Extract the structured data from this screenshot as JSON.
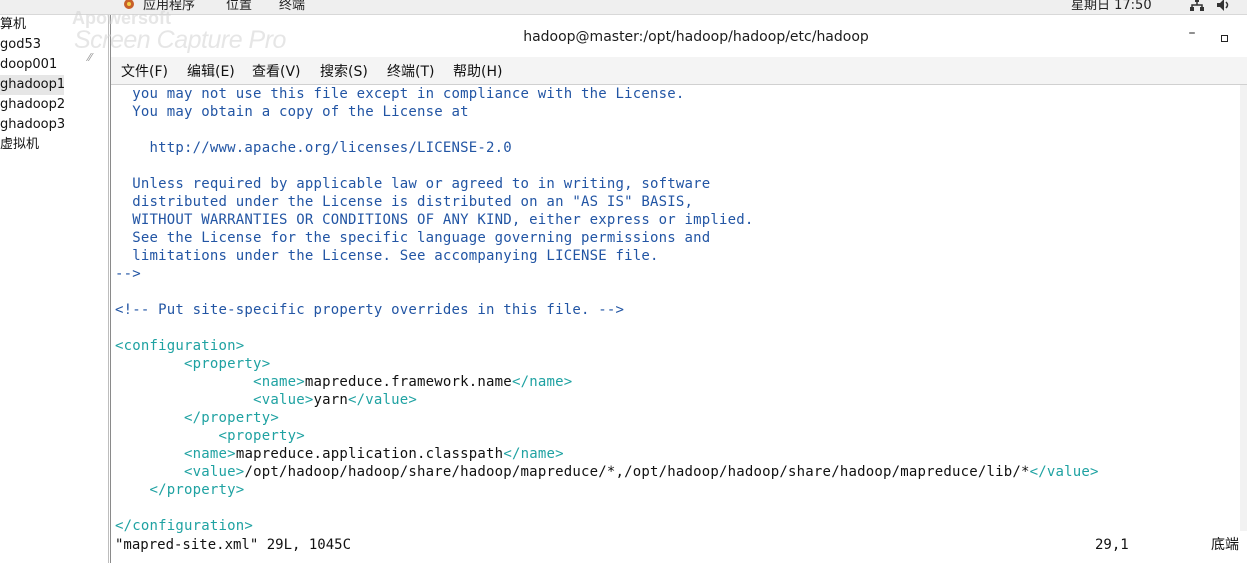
{
  "topbar": {
    "apps_label": "应用程序",
    "places_label": "位置",
    "terminal_label": "终端",
    "clock": "星期日 17:50"
  },
  "watermark": {
    "brand": "Apowersoft",
    "product": "Screen Capture Pro"
  },
  "vm_panel": {
    "items": [
      "算机",
      "god53",
      "doop001",
      "ghadoop1",
      "ghadoop2",
      "ghadoop3",
      "虚拟机"
    ],
    "selected_index": 3
  },
  "terminal": {
    "title": "hadoop@master:/opt/hadoop/hadoop/etc/hadoop",
    "min_glyph": "–",
    "menu": [
      "文件(F)",
      "编辑(E)",
      "查看(V)",
      "搜索(S)",
      "终端(T)",
      "帮助(H)"
    ]
  },
  "editor": {
    "lines": [
      {
        "text": "  you may not use this file except in compliance with the License.",
        "color": "comment"
      },
      {
        "text": "  You may obtain a copy of the License at",
        "color": "comment"
      },
      {
        "text": "",
        "color": "comment"
      },
      {
        "text": "    http://www.apache.org/licenses/LICENSE-2.0",
        "color": "comment"
      },
      {
        "text": "",
        "color": "comment"
      },
      {
        "text": "  Unless required by applicable law or agreed to in writing, software",
        "color": "comment"
      },
      {
        "text": "  distributed under the License is distributed on an \"AS IS\" BASIS,",
        "color": "comment"
      },
      {
        "text": "  WITHOUT WARRANTIES OR CONDITIONS OF ANY KIND, either express or implied.",
        "color": "comment"
      },
      {
        "text": "  See the License for the specific language governing permissions and",
        "color": "comment"
      },
      {
        "text": "  limitations under the License. See accompanying LICENSE file.",
        "color": "comment"
      },
      {
        "text": "-->",
        "color": "comment"
      },
      {
        "text": "",
        "color": "comment"
      },
      {
        "text": "<!-- Put site-specific property overrides in this file. -->",
        "color": "comment"
      },
      {
        "text": "",
        "color": "comment"
      },
      {
        "text": "<configuration>",
        "color": "tag"
      },
      {
        "text": "        <property>",
        "color": "tag"
      },
      {
        "text": "                <name>mapreduce.framework.name</name>",
        "color": "tag"
      },
      {
        "text": "                <value>yarn</value>",
        "color": "tag"
      },
      {
        "text": "        </property>",
        "color": "tag"
      },
      {
        "text": "            <property>",
        "color": "tag"
      },
      {
        "text": "        <name>mapreduce.application.classpath</name>",
        "color": "tag"
      },
      {
        "text": "        <value>/opt/hadoop/hadoop/share/hadoop/mapreduce/*,/opt/hadoop/hadoop/share/hadoop/mapreduce/lib/*</value>",
        "color": "tag"
      },
      {
        "text": "    </property>",
        "color": "tag"
      },
      {
        "text": "",
        "color": "tag"
      },
      {
        "text": "</configuration>",
        "color": "tag"
      }
    ]
  },
  "status": {
    "file_info": "\"mapred-site.xml\" 29L, 1045C",
    "cursor_pos": "29,1",
    "scroll_label": "底端"
  },
  "colors": {
    "comment": "#2255a4",
    "tag": "#1fa2a2",
    "text": "#111111"
  }
}
